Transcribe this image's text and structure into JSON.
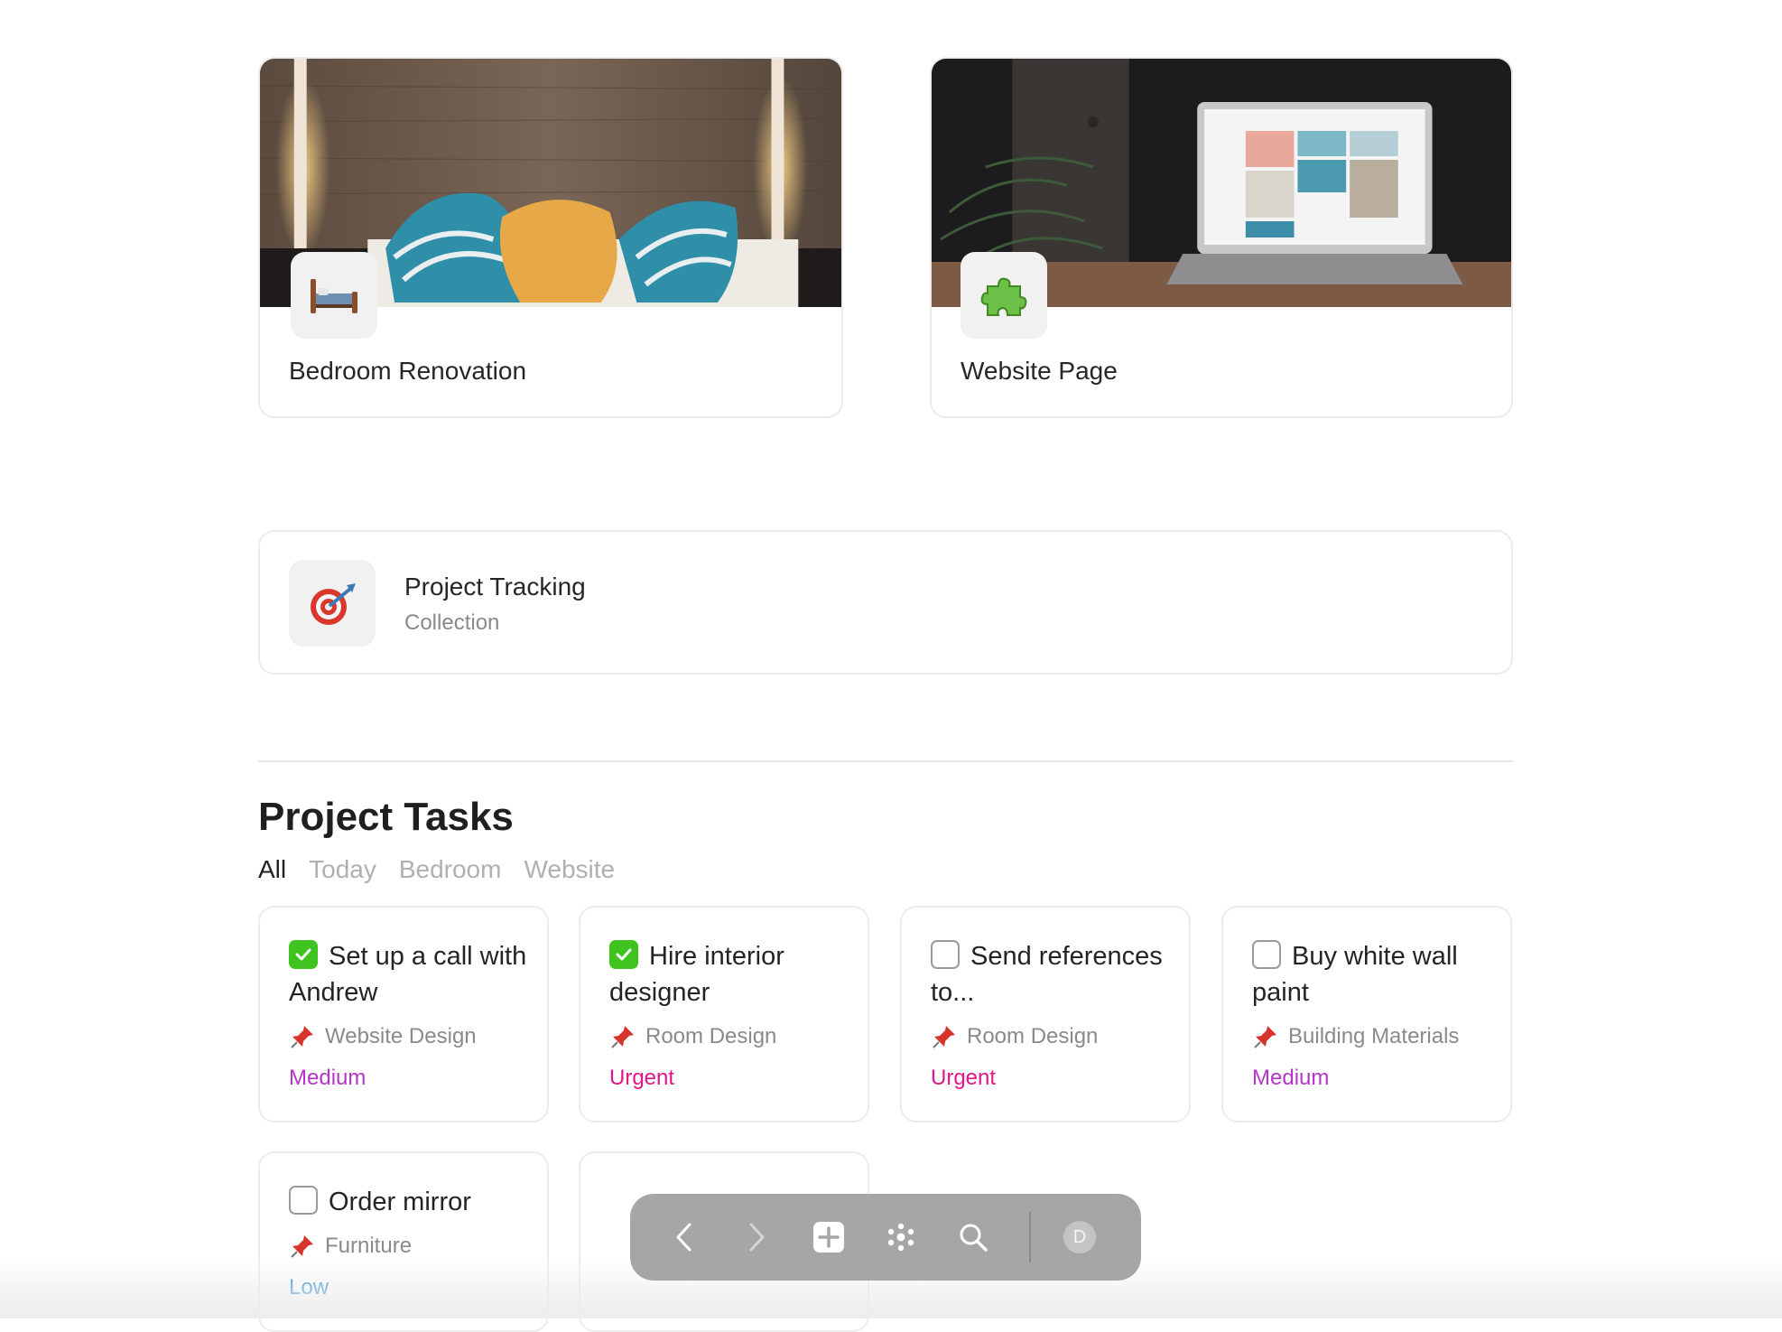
{
  "pages": [
    {
      "title": "Bedroom Renovation",
      "icon": "bed-icon"
    },
    {
      "title": "Website Page",
      "icon": "puzzle-piece-icon"
    }
  ],
  "collection": {
    "title": "Project Tracking",
    "subtitle": "Collection",
    "icon": "target-dart-icon"
  },
  "tasks_section": {
    "title": "Project Tasks",
    "filters": [
      "All",
      "Today",
      "Bedroom",
      "Website"
    ],
    "active_filter": "All"
  },
  "tasks": [
    {
      "title": "Set up a call with Andrew",
      "done": true,
      "category": "Website Design",
      "priority": "Medium",
      "priority_color": "#b535c8"
    },
    {
      "title": "Hire interior designer",
      "done": true,
      "category": "Room Design",
      "priority": "Urgent",
      "priority_color": "#e0178a"
    },
    {
      "title": "Send references to...",
      "done": false,
      "category": "Room Design",
      "priority": "Urgent",
      "priority_color": "#e0178a"
    },
    {
      "title": "Buy white wall paint",
      "done": false,
      "category": "Building Materials",
      "priority": "Medium",
      "priority_color": "#b535c8"
    },
    {
      "title": "Order mirror",
      "done": false,
      "category": "Furniture",
      "priority": "Low",
      "priority_color": "#2b8ed6"
    }
  ],
  "toolbar": {
    "buttons": [
      "back-icon",
      "forward-icon",
      "new-page-icon",
      "apps-icon",
      "search-icon"
    ],
    "avatar_letter": "D"
  },
  "colors": {
    "check_green": "#3ec31f",
    "toolbar_bg": "#a6a6a6"
  }
}
